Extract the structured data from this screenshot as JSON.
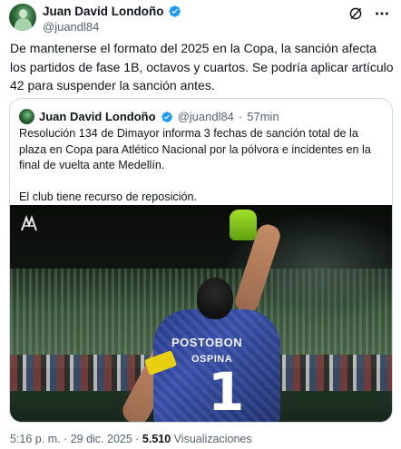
{
  "author": {
    "name": "Juan David Londoño",
    "handle": "@juandl84"
  },
  "header": {
    "grok_icon": "grok-icon",
    "more_icon": "more-options-icon"
  },
  "tweet": {
    "text": "De mantenerse el formato del 2025 en la Copa, la sanción afecta los partidos de fase 1B, octavos y cuartos. Se podría aplicar artículo 42 para suspender la sanción antes."
  },
  "quote": {
    "name": "Juan David Londoño",
    "handle": "@juandl84",
    "separator": "·",
    "time": "57min",
    "paragraph1": "Resolución 134 de Dimayor informa 3 fechas de sanción total de la plaza en Copa para Atlético Nacional por la pólvora e incidentes en la final de vuelta ante Medellín.",
    "paragraph2": "El club tiene recurso de reposición.",
    "image": {
      "sponsor": "POSTOBON",
      "player_name": "OSPINA",
      "number": "1"
    }
  },
  "footer": {
    "timestamp": "5:16 p. m. · 29 dic. 2025 · ",
    "views_count": "5.510",
    "views_label": " Visualizaciones"
  },
  "colors": {
    "verified": "#1d9bf0",
    "muted_text": "#536471",
    "text": "#0f1419",
    "border": "#cfd9de"
  }
}
